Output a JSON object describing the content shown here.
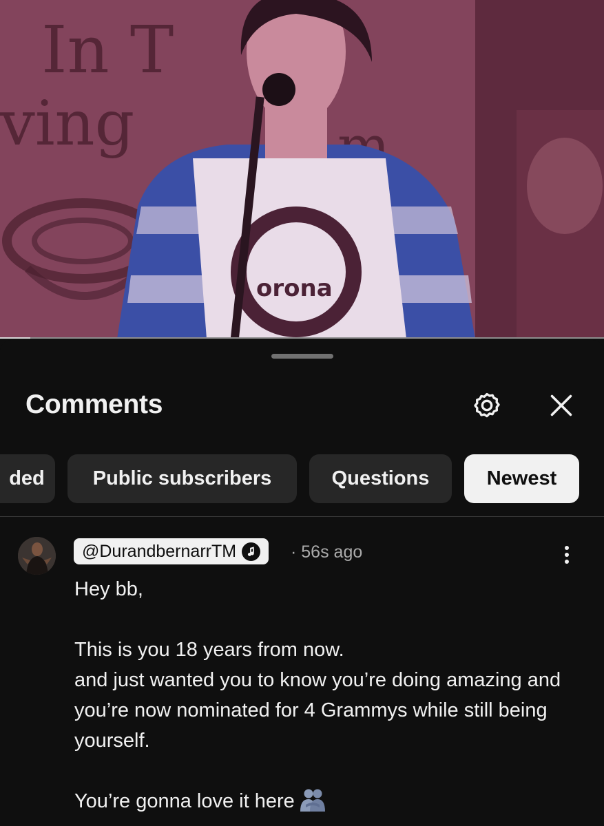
{
  "header": {
    "title": "Comments",
    "settings_icon": "gear-icon",
    "close_icon": "close-icon"
  },
  "video": {
    "progress_fraction": 0.05
  },
  "filters": {
    "chips": [
      {
        "label": "ded",
        "active": false
      },
      {
        "label": "Public subscribers",
        "active": false
      },
      {
        "label": "Questions",
        "active": false
      },
      {
        "label": "Newest",
        "active": true
      }
    ]
  },
  "comment": {
    "author": "@DurandbernarrTM",
    "badge_icon": "music-note-icon",
    "separator": "·",
    "time": "56s ago",
    "text": "Hey bb,\n\nThis is you 18 years from now.\nand just wanted you to know you’re doing amazing and you’re now nominated for 4 Grammys while still being yourself.\n\nYou’re gonna love it here",
    "emoji": "people-hugging-emoji",
    "more_icon": "more-vertical-icon"
  },
  "colors": {
    "background": "#0f0f0f",
    "chip": "#272727",
    "chip_active": "#f1f1f1",
    "muted_text": "#aaaaaa"
  }
}
